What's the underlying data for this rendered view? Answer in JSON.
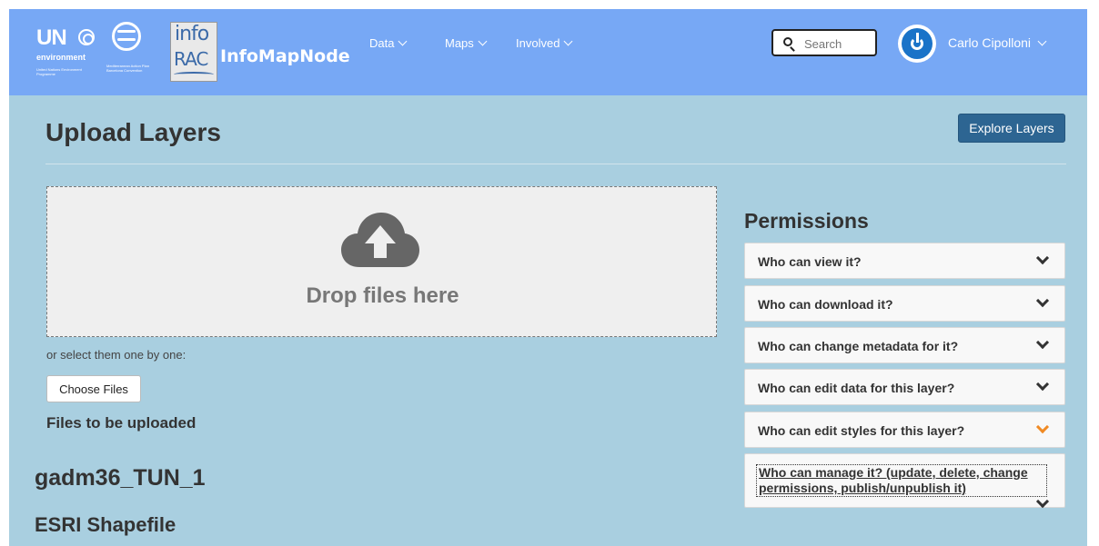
{
  "header": {
    "un_logo": {
      "title": "UN",
      "subtitle": "environment",
      "small_text": "United Nations Environment Programme"
    },
    "map_logo": {
      "small_text": "Mediterranean Action Plan Barcelona Convention"
    },
    "info_logo": {
      "top": "info",
      "bottom": "RAC"
    },
    "brand": "InfoMapNode",
    "nav": [
      {
        "label": "Data"
      },
      {
        "label": "Maps"
      },
      {
        "label": "Involved"
      }
    ],
    "search": {
      "placeholder": "Search",
      "value": ""
    },
    "user": {
      "name": "Carlo Cipolloni"
    },
    "colors": {
      "navbar": "#77a8f5",
      "page": "#a9cfe0",
      "avatar": "#1a73c8"
    }
  },
  "main": {
    "title": "Upload Layers",
    "explore_button": "Explore Layers",
    "dropzone": {
      "text": "Drop files here",
      "icon": "cloud-upload-icon"
    },
    "select_hint": "or select them one by one:",
    "choose_button": "Choose Files",
    "files_heading": "Files to be uploaded",
    "file": {
      "name": "gadm36_TUN_1",
      "type": "ESRI Shapefile"
    }
  },
  "permissions": {
    "title": "Permissions",
    "items": [
      {
        "label": "Who can view it?",
        "icon": "chevron-down-icon"
      },
      {
        "label": "Who can download it?",
        "icon": "chevron-down-icon"
      },
      {
        "label": "Who can change metadata for it?",
        "icon": "chevron-down-icon"
      },
      {
        "label": "Who can edit data for this layer?",
        "icon": "chevron-down-icon"
      },
      {
        "label": "Who can edit styles for this layer?",
        "icon": "chevron-down-icon",
        "highlight_color": "#f08a24"
      },
      {
        "label": "Who can manage it? (update, delete, change permissions, publish/unpublish it)",
        "icon": "chevron-down-icon"
      }
    ]
  }
}
